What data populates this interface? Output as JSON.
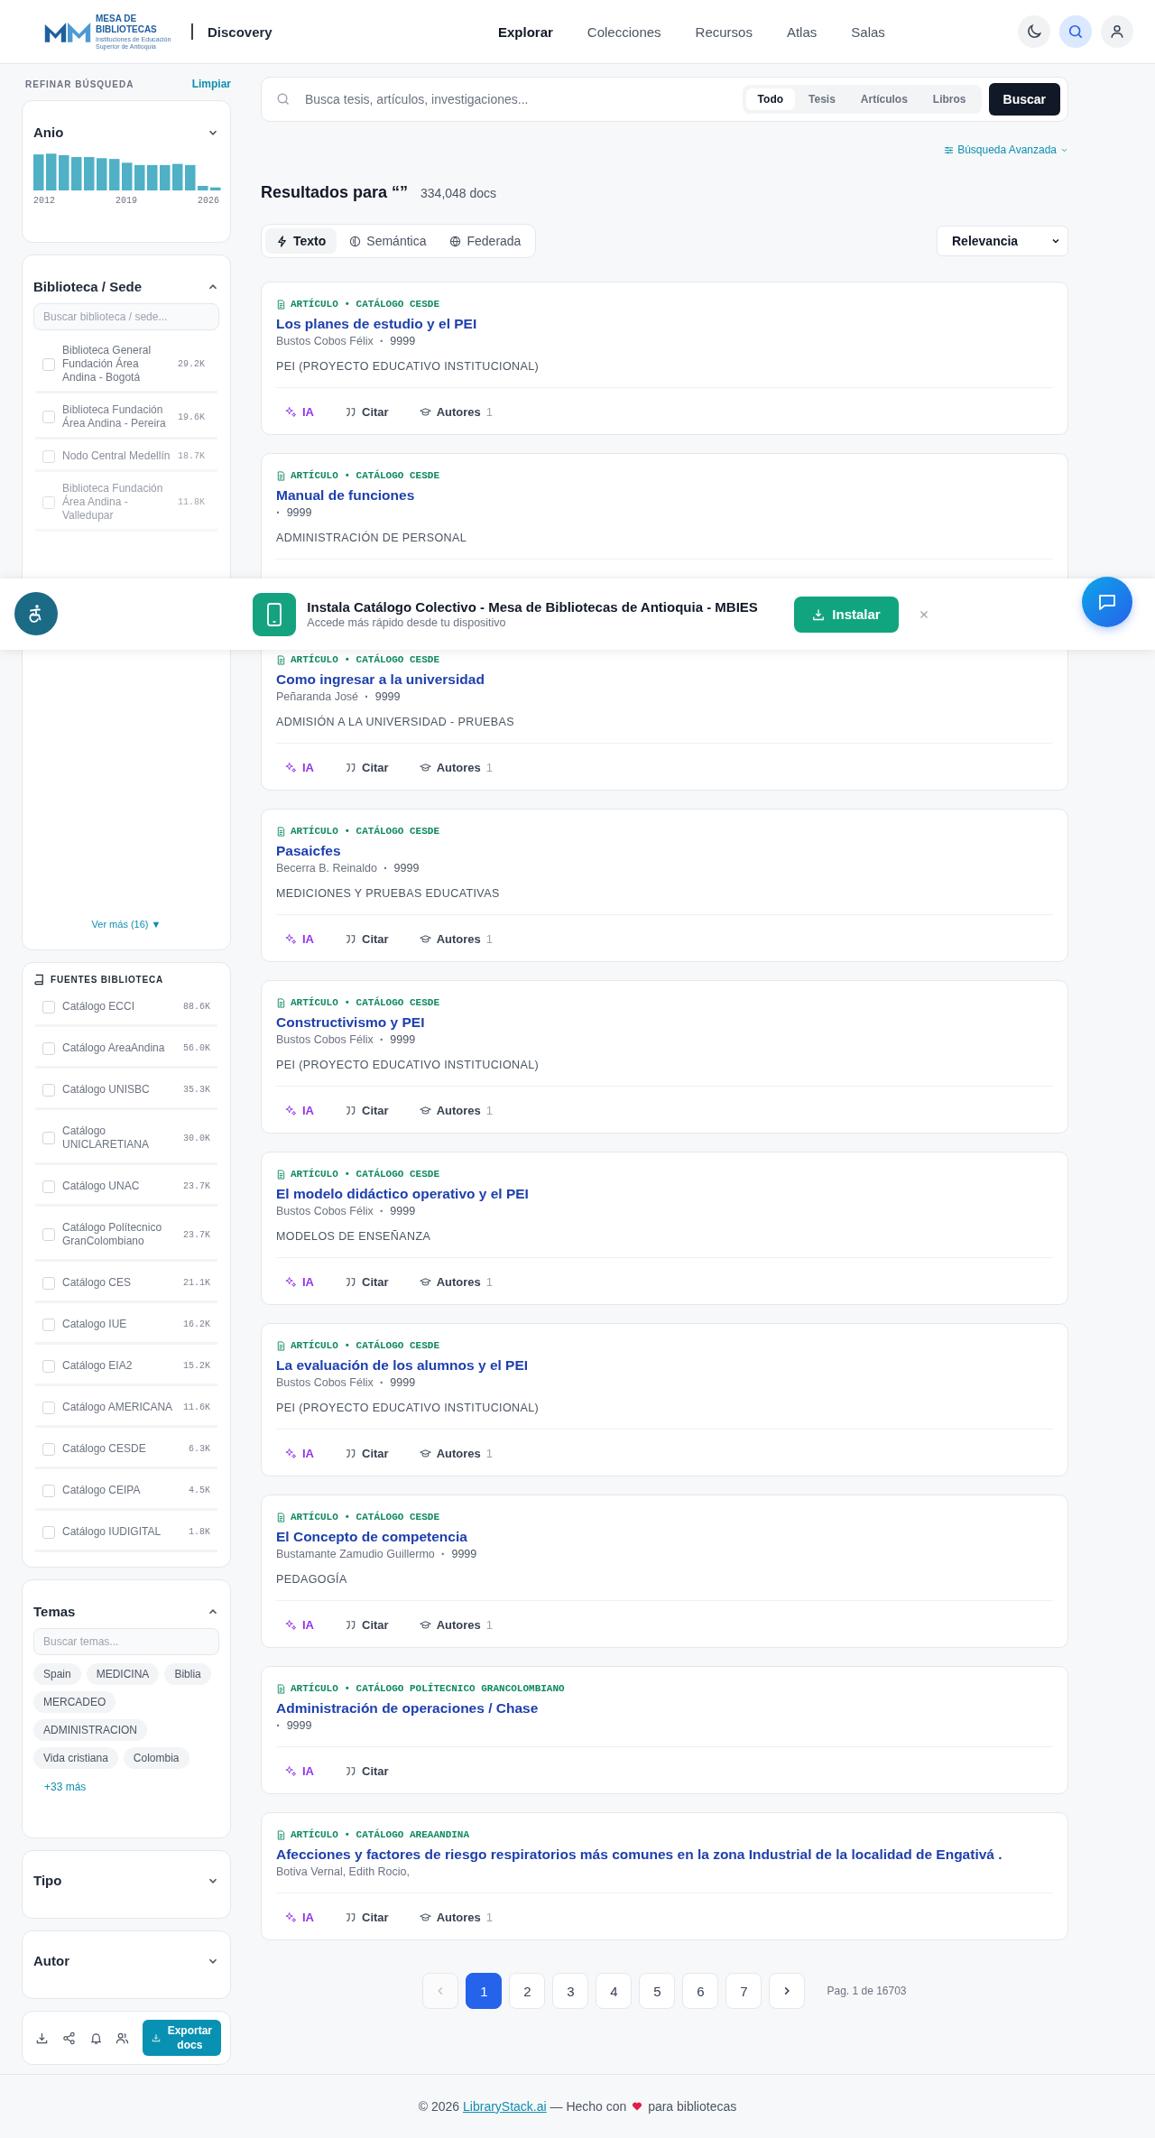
{
  "header": {
    "logo": {
      "title": "MESA DE BIBLIOTECAS",
      "subtitle": "Instituciones de Educación Superior de Antioquia"
    },
    "section": "Discovery",
    "nav": [
      {
        "label": "Explorar",
        "selected": true
      },
      {
        "label": "Colecciones",
        "selected": false
      },
      {
        "label": "Recursos",
        "selected": false
      },
      {
        "label": "Atlas",
        "selected": false
      },
      {
        "label": "Salas",
        "selected": false
      }
    ],
    "tools": [
      {
        "kind": "theme",
        "selected": false
      },
      {
        "kind": "search",
        "selected": true
      },
      {
        "kind": "user",
        "selected": false
      }
    ]
  },
  "sidebar": {
    "title": "REFINAR BÚSQUEDA",
    "clear": "Limpiar",
    "year": {
      "title": "Anio",
      "expanded": true,
      "axis_labels": [
        "2012",
        "2019",
        "2026"
      ]
    },
    "library": {
      "title": "Biblioteca / Sede",
      "expanded": true,
      "placeholder": "Buscar biblioteca / sede...",
      "more": "Ver más (16) ▼",
      "items": [
        {
          "label": "Biblioteca General Fundación Área Andina - Bogotá",
          "count": "29.2K",
          "checked": false
        },
        {
          "label": "Biblioteca Fundación Área Andina - Pereira",
          "count": "19.6K",
          "checked": false
        },
        {
          "label": "Nodo Central Medellín",
          "count": "18.7K",
          "checked": false
        },
        {
          "label": "Biblioteca Fundación Área Andina - Valledupar",
          "count": "11.8K",
          "checked": false
        }
      ]
    },
    "sources": {
      "title": "FUENTES BIBLIOTECA",
      "items": [
        {
          "label": "Catálogo ECCI",
          "count": "88.6K",
          "checked": false
        },
        {
          "label": "Catálogo AreaAndina",
          "count": "56.0K",
          "checked": false
        },
        {
          "label": "Catálogo UNISBC",
          "count": "35.3K",
          "checked": false
        },
        {
          "label": "Catálogo UNICLARETIANA",
          "count": "30.0K",
          "checked": false
        },
        {
          "label": "Catálogo UNAC",
          "count": "23.7K",
          "checked": false
        },
        {
          "label": "Catálogo Polítecnico GranColombiano",
          "count": "23.7K",
          "checked": false
        },
        {
          "label": "Catálogo CES",
          "count": "21.1K",
          "checked": false
        },
        {
          "label": "Catalogo IUE",
          "count": "16.2K",
          "checked": false
        },
        {
          "label": "Catálogo EIA2",
          "count": "15.2K",
          "checked": false
        },
        {
          "label": "Catálogo AMERICANA",
          "count": "11.6K",
          "checked": false
        },
        {
          "label": "Catálogo CESDE",
          "count": "6.3K",
          "checked": false
        },
        {
          "label": "Catálogo CEIPA",
          "count": "4.5K",
          "checked": false
        },
        {
          "label": "Catálogo IUDIGITAL",
          "count": "1.8K",
          "checked": false
        }
      ]
    },
    "topics": {
      "title": "Temas",
      "expanded": true,
      "placeholder": "Buscar temas...",
      "chips": [
        "Spain",
        "MEDICINA",
        "Biblia",
        "MERCADEO",
        "ADMINISTRACION",
        "Vida cristiana",
        "Colombia"
      ],
      "more": "+33 más"
    },
    "collapsed": [
      {
        "title": "Tipo",
        "expanded": false
      },
      {
        "title": "Autor",
        "expanded": false
      }
    ],
    "toolbar": {
      "tools": [
        {
          "kind": "download"
        },
        {
          "kind": "share"
        },
        {
          "kind": "bell"
        },
        {
          "kind": "users"
        }
      ],
      "export": "Exportar docs"
    }
  },
  "search": {
    "placeholder": "Busca tesis, artículos, investigaciones...",
    "scopes": [
      {
        "label": "Todo",
        "selected": true
      },
      {
        "label": "Tesis",
        "selected": false
      },
      {
        "label": "Artículos",
        "selected": false
      },
      {
        "label": "Libros",
        "selected": false
      }
    ],
    "button": "Buscar",
    "advanced": "Búsqueda Avanzada"
  },
  "results": {
    "heading": "Resultados para “”",
    "count": "334,048 docs",
    "modes": [
      {
        "kind": "text",
        "label": "Texto",
        "selected": true
      },
      {
        "kind": "semantic",
        "label": "Semántica",
        "selected": false
      },
      {
        "kind": "federated",
        "label": "Federada",
        "selected": false
      }
    ],
    "sort": "Relevancia",
    "cards": [
      {
        "tag": "ARTÍCULO • CATÁLOGO CESDE",
        "title": "Los planes de estudio y el PEI",
        "author": "Bustos Cobos Félix",
        "sep": "·",
        "year": "9999",
        "subject": "PEI (PROYECTO EDUCATIVO INSTITUCIONAL)",
        "actions": [
          {
            "kind": "ai",
            "label": "IA"
          },
          {
            "kind": "cite",
            "label": "Citar"
          },
          {
            "kind": "authors",
            "label": "Autores",
            "count": "1"
          }
        ]
      },
      {
        "tag": "ARTÍCULO • CATÁLOGO CESDE",
        "title": "Manual de funciones",
        "sep": "·",
        "year": "9999",
        "subject": "ADMINISTRACIÓN DE PERSONAL"
      },
      {
        "tag": "ARTÍCULO • CATÁLOGO CESDE",
        "title": "Como ingresar a la universidad",
        "author": "Peñaranda José",
        "sep": "·",
        "year": "9999",
        "subject": "ADMISIÓN A LA UNIVERSIDAD - PRUEBAS",
        "actions": [
          {
            "kind": "ai",
            "label": "IA"
          },
          {
            "kind": "cite",
            "label": "Citar"
          },
          {
            "kind": "authors",
            "label": "Autores",
            "count": "1"
          }
        ]
      },
      {
        "tag": "ARTÍCULO • CATÁLOGO CESDE",
        "title": "Pasaicfes",
        "author": "Becerra B. Reinaldo",
        "sep": "·",
        "year": "9999",
        "subject": "MEDICIONES Y PRUEBAS EDUCATIVAS",
        "actions": [
          {
            "kind": "ai",
            "label": "IA"
          },
          {
            "kind": "cite",
            "label": "Citar"
          },
          {
            "kind": "authors",
            "label": "Autores",
            "count": "1"
          }
        ]
      },
      {
        "tag": "ARTÍCULO • CATÁLOGO CESDE",
        "title": "Constructivismo y PEI",
        "author": "Bustos Cobos Félix",
        "sep": "·",
        "year": "9999",
        "subject": "PEI (PROYECTO EDUCATIVO INSTITUCIONAL)",
        "actions": [
          {
            "kind": "ai",
            "label": "IA"
          },
          {
            "kind": "cite",
            "label": "Citar"
          },
          {
            "kind": "authors",
            "label": "Autores",
            "count": "1"
          }
        ]
      },
      {
        "tag": "ARTÍCULO • CATÁLOGO CESDE",
        "title": "El modelo didáctico operativo y el PEI",
        "author": "Bustos Cobos Félix",
        "sep": "·",
        "year": "9999",
        "subject": "MODELOS DE ENSEÑANZA",
        "actions": [
          {
            "kind": "ai",
            "label": "IA"
          },
          {
            "kind": "cite",
            "label": "Citar"
          },
          {
            "kind": "authors",
            "label": "Autores",
            "count": "1"
          }
        ]
      },
      {
        "tag": "ARTÍCULO • CATÁLOGO CESDE",
        "title": "La evaluación de los alumnos y el PEI",
        "author": "Bustos Cobos Félix",
        "sep": "·",
        "year": "9999",
        "subject": "PEI (PROYECTO EDUCATIVO INSTITUCIONAL)",
        "actions": [
          {
            "kind": "ai",
            "label": "IA"
          },
          {
            "kind": "cite",
            "label": "Citar"
          },
          {
            "kind": "authors",
            "label": "Autores",
            "count": "1"
          }
        ]
      },
      {
        "tag": "ARTÍCULO • CATÁLOGO CESDE",
        "title": "El Concepto de competencia",
        "author": "Bustamante Zamudio Guillermo",
        "sep": "·",
        "year": "9999",
        "subject": "PEDAGOGÍA",
        "actions": [
          {
            "kind": "ai",
            "label": "IA"
          },
          {
            "kind": "cite",
            "label": "Citar"
          },
          {
            "kind": "authors",
            "label": "Autores",
            "count": "1"
          }
        ]
      },
      {
        "tag": "ARTÍCULO • CATÁLOGO POLÍTECNICO GRANCOLOMBIANO",
        "title": "Administración de operaciones / Chase",
        "sep": "·",
        "year": "9999",
        "actions": [
          {
            "kind": "ai",
            "label": "IA"
          },
          {
            "kind": "cite",
            "label": "Citar"
          }
        ]
      },
      {
        "tag": "ARTÍCULO • CATÁLOGO AREAANDINA",
        "title": "Afecciones y factores de riesgo respiratorios más comunes en la zona Industrial de la localidad de Engativá .",
        "author": "Botiva Vernal, Edith Rocio,",
        "actions": [
          {
            "kind": "ai",
            "label": "IA"
          },
          {
            "kind": "cite",
            "label": "Citar"
          },
          {
            "kind": "authors",
            "label": "Autores",
            "count": "1"
          }
        ]
      }
    ],
    "pagination": {
      "prev_disabled": true,
      "pages": [
        {
          "label": "1",
          "selected": true
        },
        {
          "label": "2",
          "selected": false
        },
        {
          "label": "3",
          "selected": false
        },
        {
          "label": "4",
          "selected": false
        },
        {
          "label": "5",
          "selected": false
        },
        {
          "label": "6",
          "selected": false
        },
        {
          "label": "7",
          "selected": false
        }
      ],
      "summary": "Pag. 1 de 16703"
    }
  },
  "install_banner": {
    "title": "Instala Catálogo Colectivo - Mesa de Bibliotecas de Antioquia - MBIES",
    "subtitle": "Accede más rápido desde tu dispositivo",
    "button": "Instalar"
  },
  "footer": {
    "before": "© 2026 ",
    "link": "LibraryStack.ai",
    "middle": " — Hecho con ",
    "after": " para bibliotecas"
  }
}
